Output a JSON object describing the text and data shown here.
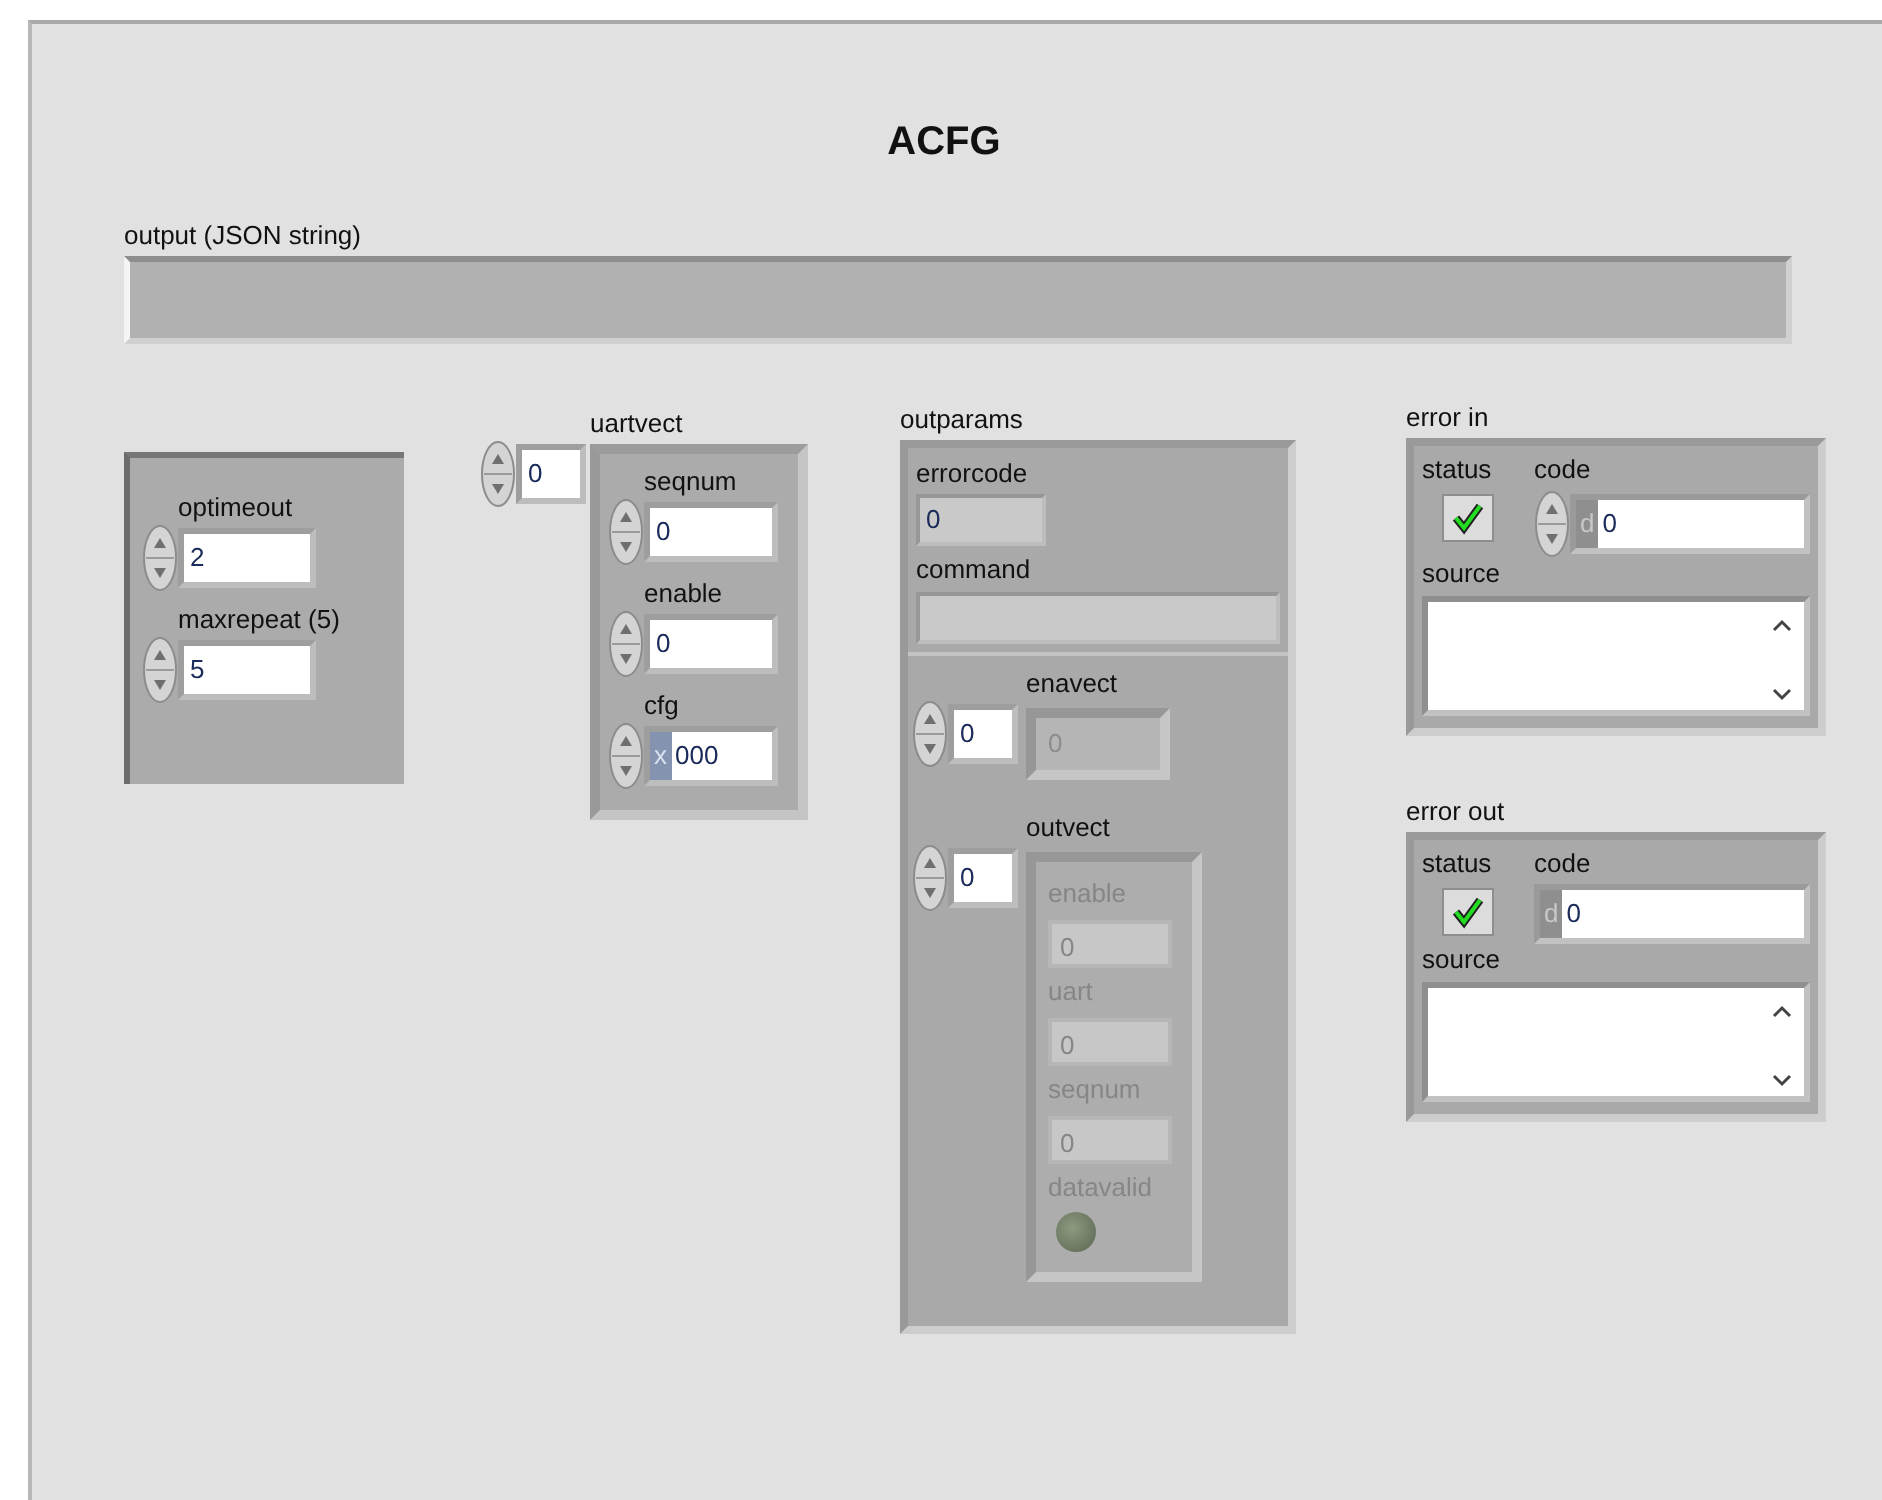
{
  "title": "ACFG",
  "output": {
    "label": "output (JSON string)"
  },
  "settings": {
    "controls": [
      {
        "label": "optimeout",
        "value": "2"
      },
      {
        "label": "maxrepeat (5)",
        "value": "5"
      }
    ]
  },
  "uartvect": {
    "label": "uartvect",
    "index": "0",
    "fields": [
      {
        "label": "seqnum",
        "value": "0"
      },
      {
        "label": "enable",
        "value": "0"
      },
      {
        "label": "cfg",
        "radix": "x",
        "value": "000"
      }
    ]
  },
  "outparams": {
    "label": "outparams",
    "errorcode": {
      "label": "errorcode",
      "value": "0"
    },
    "command": {
      "label": "command"
    },
    "enavect": {
      "label": "enavect",
      "index": "0",
      "value": "0",
      "disabled": true
    },
    "outvect": {
      "label": "outvect",
      "index": "0",
      "disabled": true,
      "fields": [
        {
          "kind": "number",
          "label": "enable",
          "value": "0"
        },
        {
          "kind": "number",
          "label": "uart",
          "value": "0"
        },
        {
          "kind": "number",
          "label": "seqnum",
          "value": "0"
        },
        {
          "kind": "led",
          "label": "datavalid",
          "on": false
        }
      ]
    }
  },
  "error_clusters": [
    {
      "label": "error in",
      "status_label": "status",
      "status": false,
      "code_label": "code",
      "spinner": true,
      "radix": "d",
      "code": "0",
      "source_label": "source"
    },
    {
      "label": "error out",
      "status_label": "status",
      "status": false,
      "code_label": "code",
      "spinner": false,
      "radix": "d",
      "code": "0",
      "source_label": "source"
    }
  ]
}
